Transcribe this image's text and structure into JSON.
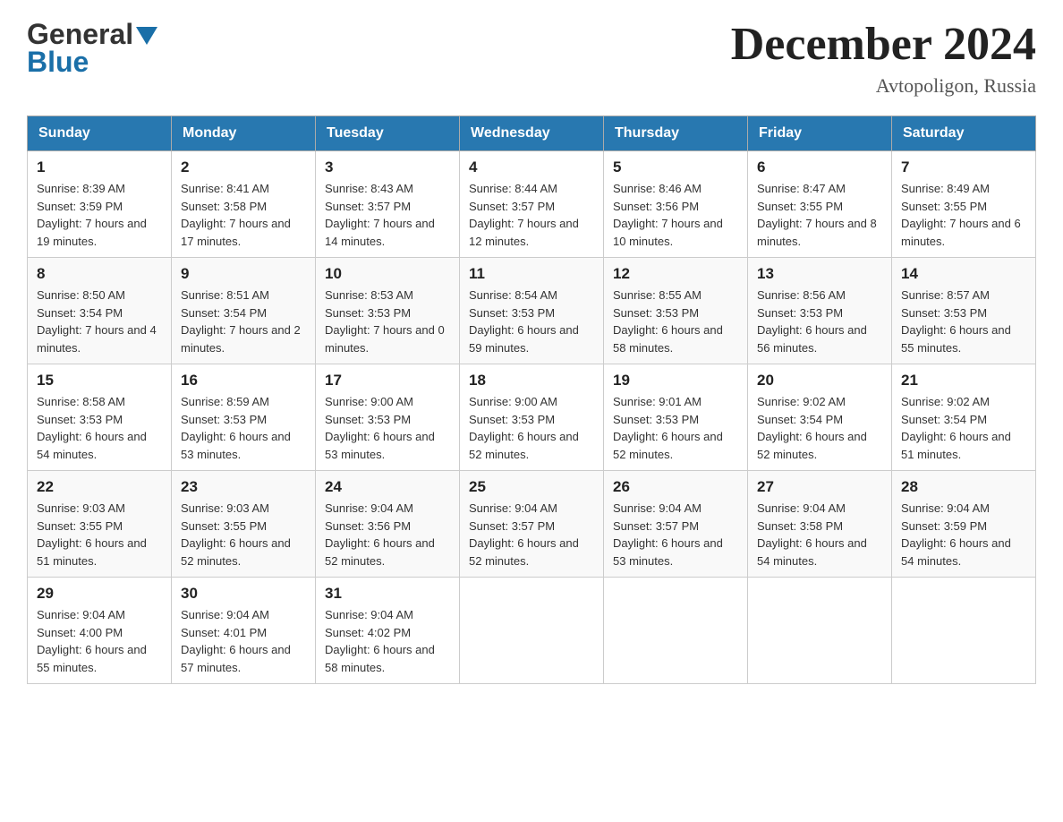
{
  "header": {
    "title": "December 2024",
    "location": "Avtopoligon, Russia",
    "logo_general": "General",
    "logo_blue": "Blue"
  },
  "days_of_week": [
    "Sunday",
    "Monday",
    "Tuesday",
    "Wednesday",
    "Thursday",
    "Friday",
    "Saturday"
  ],
  "weeks": [
    [
      {
        "day": 1,
        "sunrise": "8:39 AM",
        "sunset": "3:59 PM",
        "daylight": "7 hours and 19 minutes."
      },
      {
        "day": 2,
        "sunrise": "8:41 AM",
        "sunset": "3:58 PM",
        "daylight": "7 hours and 17 minutes."
      },
      {
        "day": 3,
        "sunrise": "8:43 AM",
        "sunset": "3:57 PM",
        "daylight": "7 hours and 14 minutes."
      },
      {
        "day": 4,
        "sunrise": "8:44 AM",
        "sunset": "3:57 PM",
        "daylight": "7 hours and 12 minutes."
      },
      {
        "day": 5,
        "sunrise": "8:46 AM",
        "sunset": "3:56 PM",
        "daylight": "7 hours and 10 minutes."
      },
      {
        "day": 6,
        "sunrise": "8:47 AM",
        "sunset": "3:55 PM",
        "daylight": "7 hours and 8 minutes."
      },
      {
        "day": 7,
        "sunrise": "8:49 AM",
        "sunset": "3:55 PM",
        "daylight": "7 hours and 6 minutes."
      }
    ],
    [
      {
        "day": 8,
        "sunrise": "8:50 AM",
        "sunset": "3:54 PM",
        "daylight": "7 hours and 4 minutes."
      },
      {
        "day": 9,
        "sunrise": "8:51 AM",
        "sunset": "3:54 PM",
        "daylight": "7 hours and 2 minutes."
      },
      {
        "day": 10,
        "sunrise": "8:53 AM",
        "sunset": "3:53 PM",
        "daylight": "7 hours and 0 minutes."
      },
      {
        "day": 11,
        "sunrise": "8:54 AM",
        "sunset": "3:53 PM",
        "daylight": "6 hours and 59 minutes."
      },
      {
        "day": 12,
        "sunrise": "8:55 AM",
        "sunset": "3:53 PM",
        "daylight": "6 hours and 58 minutes."
      },
      {
        "day": 13,
        "sunrise": "8:56 AM",
        "sunset": "3:53 PM",
        "daylight": "6 hours and 56 minutes."
      },
      {
        "day": 14,
        "sunrise": "8:57 AM",
        "sunset": "3:53 PM",
        "daylight": "6 hours and 55 minutes."
      }
    ],
    [
      {
        "day": 15,
        "sunrise": "8:58 AM",
        "sunset": "3:53 PM",
        "daylight": "6 hours and 54 minutes."
      },
      {
        "day": 16,
        "sunrise": "8:59 AM",
        "sunset": "3:53 PM",
        "daylight": "6 hours and 53 minutes."
      },
      {
        "day": 17,
        "sunrise": "9:00 AM",
        "sunset": "3:53 PM",
        "daylight": "6 hours and 53 minutes."
      },
      {
        "day": 18,
        "sunrise": "9:00 AM",
        "sunset": "3:53 PM",
        "daylight": "6 hours and 52 minutes."
      },
      {
        "day": 19,
        "sunrise": "9:01 AM",
        "sunset": "3:53 PM",
        "daylight": "6 hours and 52 minutes."
      },
      {
        "day": 20,
        "sunrise": "9:02 AM",
        "sunset": "3:54 PM",
        "daylight": "6 hours and 52 minutes."
      },
      {
        "day": 21,
        "sunrise": "9:02 AM",
        "sunset": "3:54 PM",
        "daylight": "6 hours and 51 minutes."
      }
    ],
    [
      {
        "day": 22,
        "sunrise": "9:03 AM",
        "sunset": "3:55 PM",
        "daylight": "6 hours and 51 minutes."
      },
      {
        "day": 23,
        "sunrise": "9:03 AM",
        "sunset": "3:55 PM",
        "daylight": "6 hours and 52 minutes."
      },
      {
        "day": 24,
        "sunrise": "9:04 AM",
        "sunset": "3:56 PM",
        "daylight": "6 hours and 52 minutes."
      },
      {
        "day": 25,
        "sunrise": "9:04 AM",
        "sunset": "3:57 PM",
        "daylight": "6 hours and 52 minutes."
      },
      {
        "day": 26,
        "sunrise": "9:04 AM",
        "sunset": "3:57 PM",
        "daylight": "6 hours and 53 minutes."
      },
      {
        "day": 27,
        "sunrise": "9:04 AM",
        "sunset": "3:58 PM",
        "daylight": "6 hours and 54 minutes."
      },
      {
        "day": 28,
        "sunrise": "9:04 AM",
        "sunset": "3:59 PM",
        "daylight": "6 hours and 54 minutes."
      }
    ],
    [
      {
        "day": 29,
        "sunrise": "9:04 AM",
        "sunset": "4:00 PM",
        "daylight": "6 hours and 55 minutes."
      },
      {
        "day": 30,
        "sunrise": "9:04 AM",
        "sunset": "4:01 PM",
        "daylight": "6 hours and 57 minutes."
      },
      {
        "day": 31,
        "sunrise": "9:04 AM",
        "sunset": "4:02 PM",
        "daylight": "6 hours and 58 minutes."
      },
      null,
      null,
      null,
      null
    ]
  ]
}
